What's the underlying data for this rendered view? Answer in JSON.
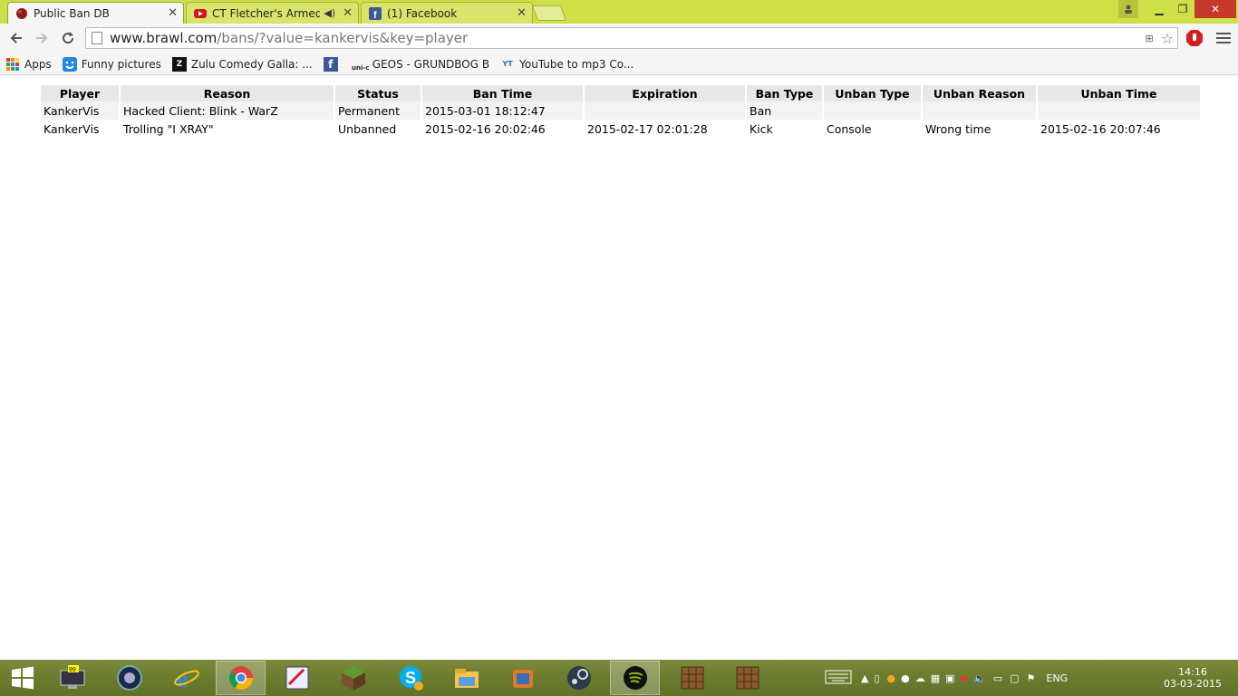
{
  "browser": {
    "tabs": [
      {
        "title": "Public Ban DB",
        "active": true
      },
      {
        "title": "CT Fletcher's Armed W",
        "active": false,
        "audio": true
      },
      {
        "title": "(1) Facebook",
        "active": false
      }
    ],
    "url": {
      "host": "www.brawl.com",
      "path": "/bans/?value=kankervis&key=player"
    }
  },
  "bookmarks": [
    {
      "label": "Apps",
      "icon": "apps-grid-icon"
    },
    {
      "label": "Funny pictures",
      "icon": "funny-pictures-icon"
    },
    {
      "label": "Zulu Comedy Galla: ...",
      "icon": "tv2-zulu-icon"
    },
    {
      "label": "",
      "icon": "facebook-icon"
    },
    {
      "label": "GEOS - GRUNDBOG B",
      "icon": "unic-icon"
    },
    {
      "label": "YouTube to mp3 Co...",
      "icon": "youtube-mp3-icon"
    }
  ],
  "ban_table": {
    "headers": [
      "Player",
      "Reason",
      "Status",
      "Ban Time",
      "Expiration",
      "Ban Type",
      "Unban Type",
      "Unban Reason",
      "Unban Time"
    ],
    "rows": [
      [
        "KankerVis",
        "Hacked Client: Blink - WarZ",
        "Permanent",
        "2015-03-01 18:12:47",
        "",
        "Ban",
        "",
        "",
        ""
      ],
      [
        "KankerVis",
        "Trolling \"I XRAY\"",
        "Unbanned",
        "2015-02-16 20:02:46",
        "2015-02-17 02:01:28",
        "Kick",
        "Console",
        "Wrong time",
        "2015-02-16 20:07:46"
      ]
    ]
  },
  "taskbar": {
    "language": "ENG",
    "time": "14:16",
    "date": "03-03-2015",
    "apps": [
      "start",
      "computer",
      "cinema4d",
      "internet-explorer",
      "chrome",
      "paint",
      "minecraft",
      "skype",
      "file-explorer",
      "misc-app",
      "steam",
      "spotify",
      "minecraft-server-1",
      "minecraft-server-2"
    ]
  }
}
